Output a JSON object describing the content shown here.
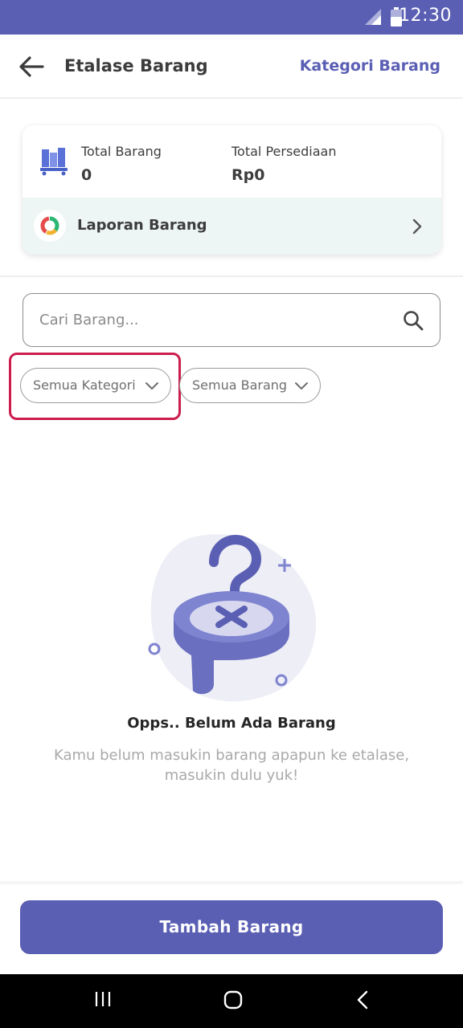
{
  "status_bar": {
    "time": "12:30"
  },
  "header": {
    "title": "Etalase Barang",
    "category_link": "Kategori Barang"
  },
  "summary": {
    "total_items_label": "Total Barang",
    "total_items_value": "0",
    "total_stock_label": "Total Persediaan",
    "total_stock_value": "Rp0",
    "report_label": "Laporan Barang"
  },
  "search": {
    "placeholder": "Cari Barang..."
  },
  "filters": {
    "category_label": "Semua Kategori",
    "item_label": "Semua Barang"
  },
  "empty_state": {
    "title": "Opps.. Belum Ada Barang",
    "description": "Kamu belum masukin barang apapun ke etalase, masukin dulu yuk!"
  },
  "actions": {
    "add_item_label": "Tambah Barang"
  },
  "colors": {
    "primary": "#5a5fb4",
    "highlight": "#cc1d4d",
    "report_bg": "#eef6f5"
  }
}
